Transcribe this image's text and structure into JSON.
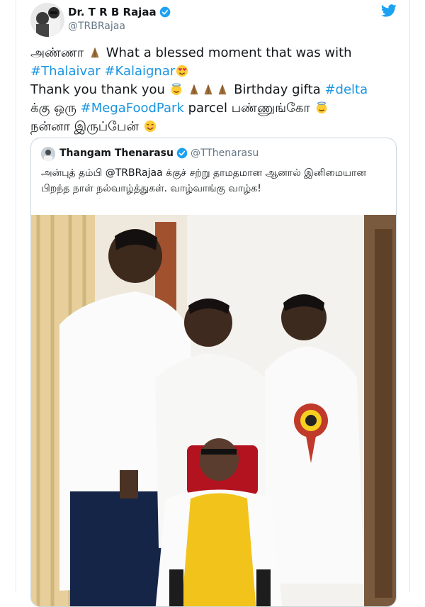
{
  "tweet": {
    "display_name": "Dr. T R B Rajaa",
    "handle": "@TRBRajaa",
    "lines": {
      "l1_a": "அண்ணா",
      "l1_b": "What a blessed moment that was with",
      "l2_tag1": "#Thalaivar",
      "l2_tag2": "#Kalaignar",
      "l3_a": "Thank you thank you",
      "l3_b": "Birthday gifta",
      "l3_tag": "#delta",
      "l4_a": "க்கு ஒரு",
      "l4_tag": "#MegaFoodPark",
      "l4_b": "parcel பண்ணுங்கோ",
      "l5_a": "நன்னா இருப்பேன்"
    },
    "icons": {
      "folded_hands": "folded-hands-icon",
      "heart_eyes": "heart-eyes-icon",
      "halo": "smiling-halo-icon",
      "smile": "smiling-face-icon",
      "verified": "verified-badge-icon",
      "twitter": "twitter-bird-icon"
    },
    "colors": {
      "link": "#1b95e0",
      "verified": "#1da1f2",
      "handle": "#657786"
    }
  },
  "quoted": {
    "display_name": "Thangam Thenarasu",
    "handle": "@TThenarasu",
    "text": "அன்புத் தம்பி @TRBRajaa க்குச் சற்று தாமதமான ஆனால் இனிமையான பிறந்த நாள் நல்வாழ்த்துகள். வாழ்வாங்கு வாழ்க!"
  }
}
